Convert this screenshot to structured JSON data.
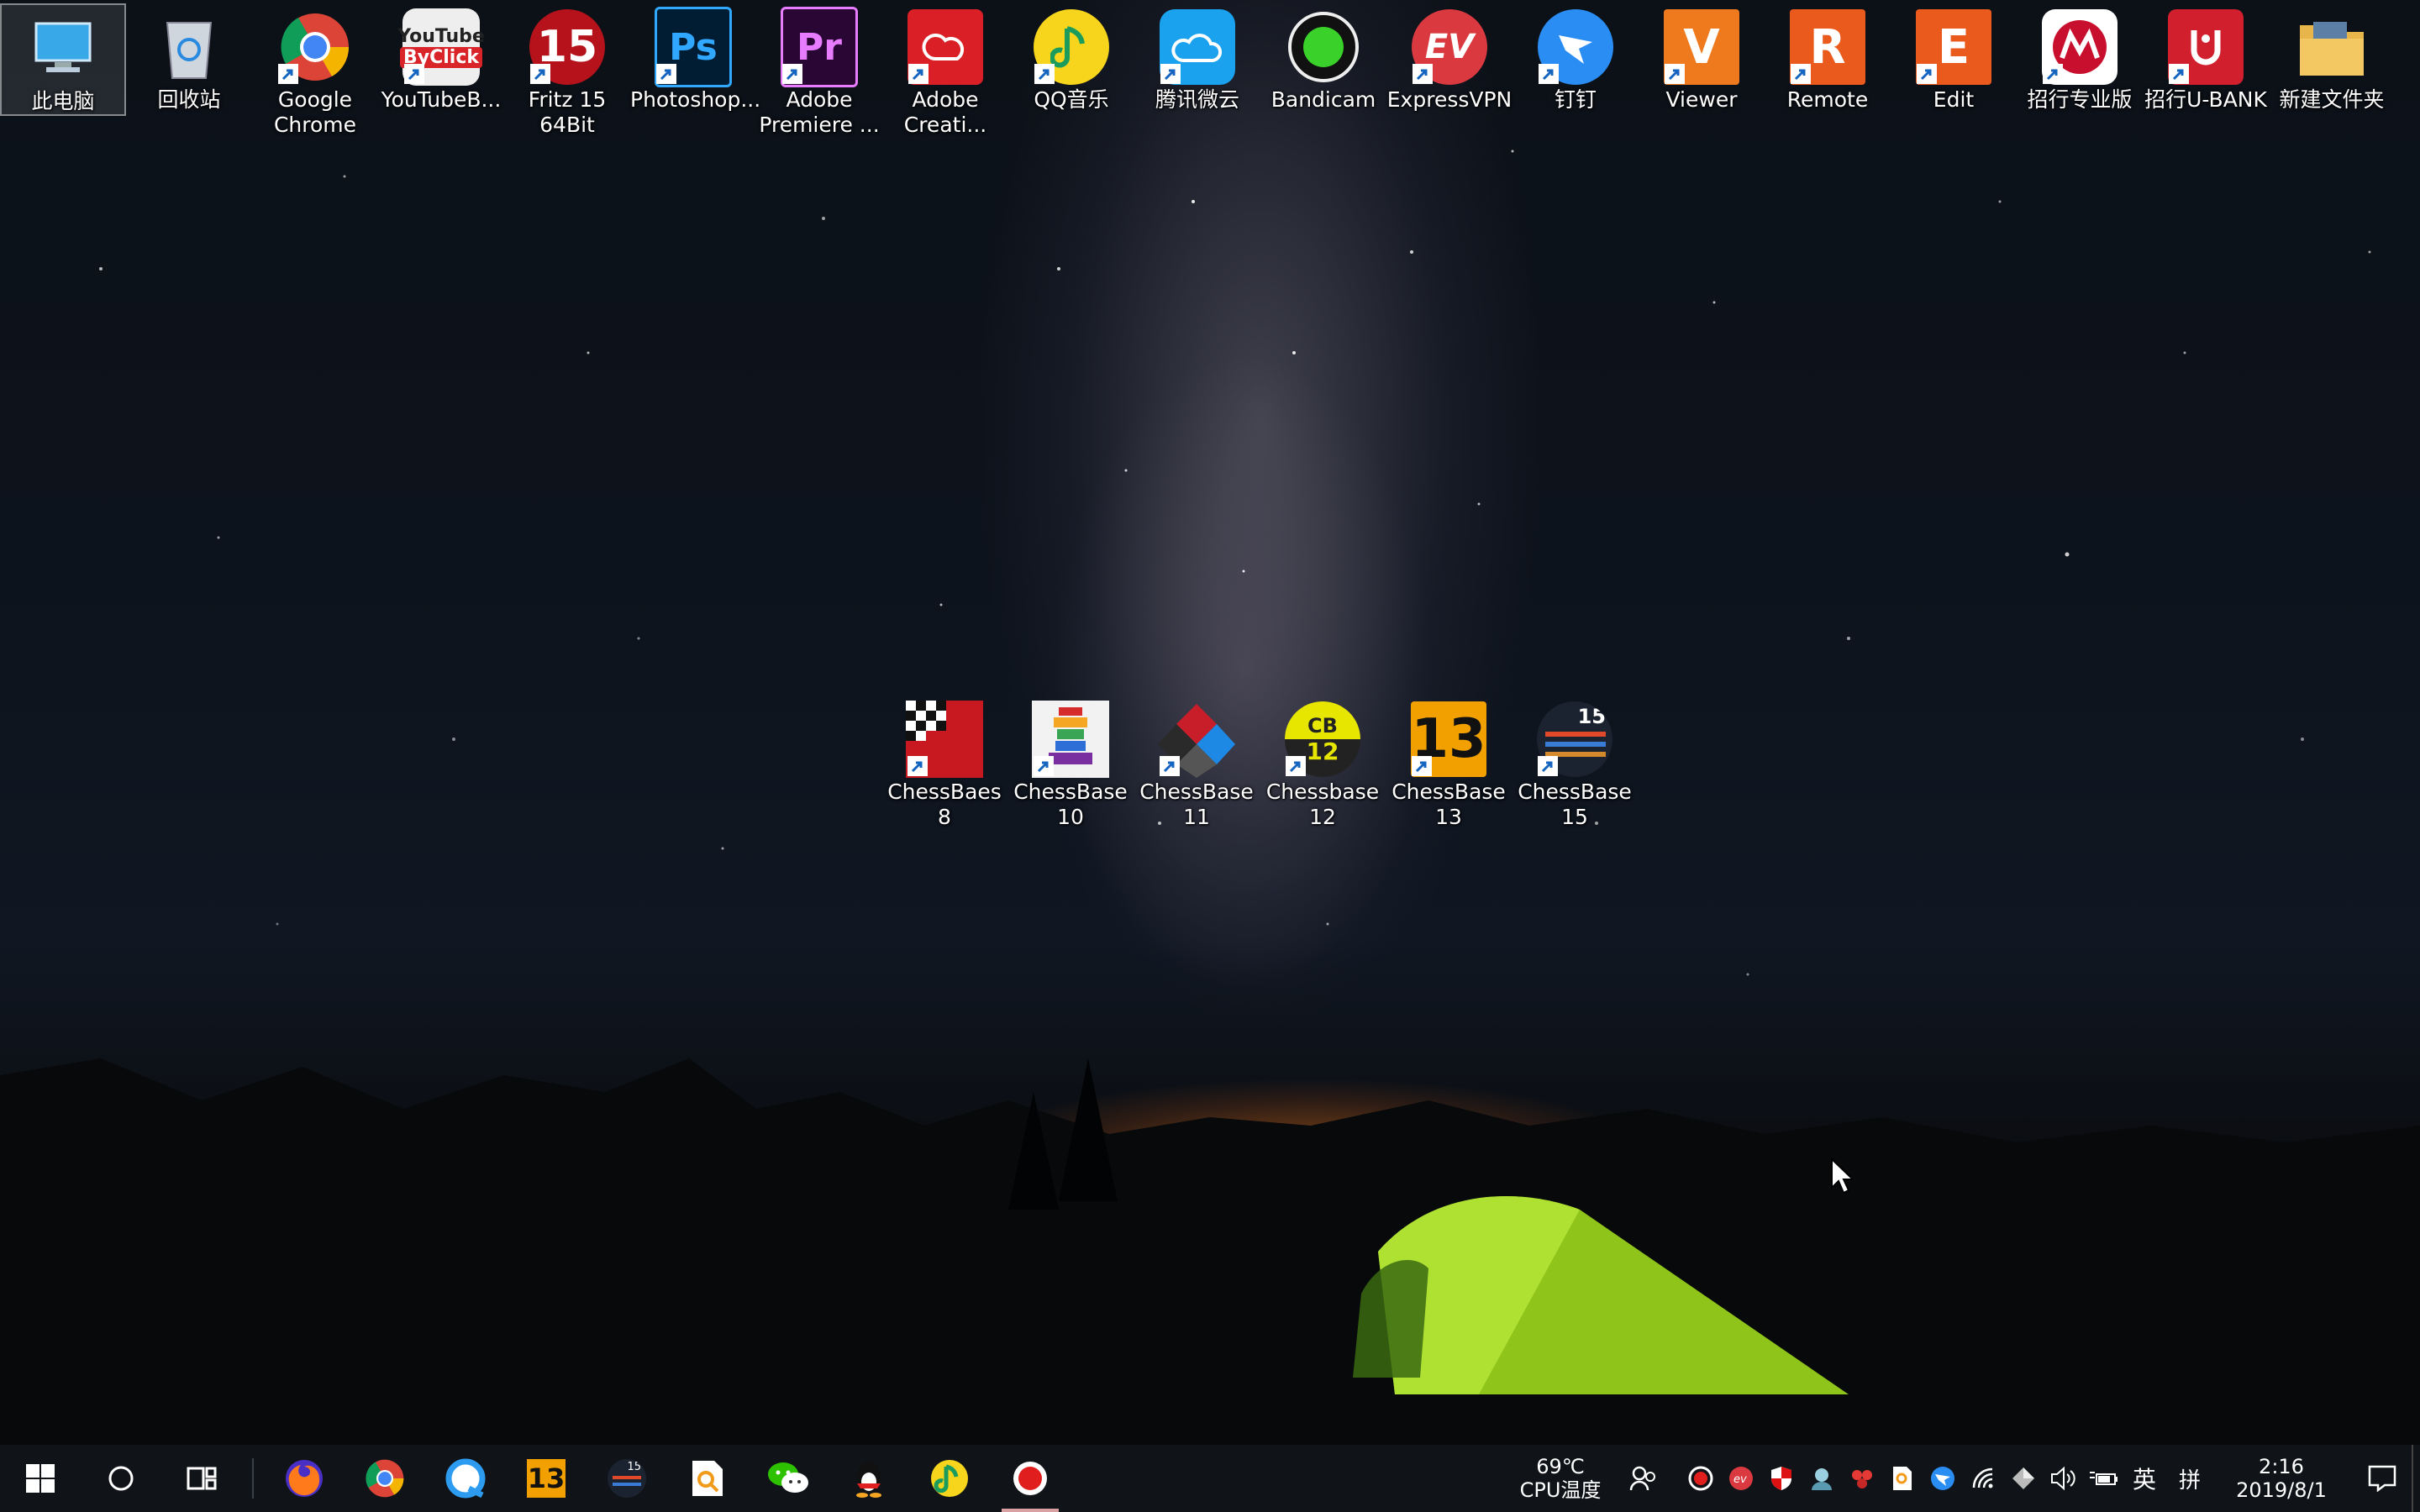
{
  "desktop": {
    "icons_top": [
      {
        "label": "此电脑"
      },
      {
        "label": "回收站"
      },
      {
        "label": "Google\nChrome"
      },
      {
        "label": "YouTubeB..."
      },
      {
        "label": "Fritz 15\n64Bit"
      },
      {
        "label": "Photoshop..."
      },
      {
        "label": "Adobe\nPremiere ..."
      },
      {
        "label": "Adobe\nCreati..."
      },
      {
        "label": "QQ音乐"
      },
      {
        "label": "腾讯微云"
      },
      {
        "label": "Bandicam"
      },
      {
        "label": "ExpressVPN"
      },
      {
        "label": "钉钉"
      },
      {
        "label": "Viewer"
      },
      {
        "label": "Remote"
      },
      {
        "label": "Edit"
      },
      {
        "label": "招行专业版"
      },
      {
        "label": "招行U-BANK"
      },
      {
        "label": "新建文件夹"
      }
    ],
    "icons_chess": [
      {
        "label": "ChessBaes\n8"
      },
      {
        "label": "ChessBase\n10"
      },
      {
        "label": "ChessBase\n11"
      },
      {
        "label": "Chessbase\n12"
      },
      {
        "label": "ChessBase\n13"
      },
      {
        "label": "ChessBase\n15"
      }
    ],
    "icon_text": {
      "youtube_line1": "YouTube",
      "youtube_line2": "ByClick",
      "fritz": "15",
      "ps": "Ps",
      "pr": "Pr",
      "viewer": "V",
      "remote": "R",
      "edit": "E",
      "cb12_top": "CB",
      "cb12_num": "12",
      "cb13": "13",
      "cb15": "15",
      "expressvpn": "EV"
    }
  },
  "taskbar": {
    "cpu_temp": "69℃",
    "cpu_label": "CPU温度",
    "ime_lang": "英",
    "ime_mode": "拼",
    "time": "2:16",
    "date": "2019/8/1",
    "app_13": "13",
    "app_15": "15"
  },
  "colors": {
    "taskbar_bg": "#101418",
    "desktop_sky": "#0d131c",
    "tent_green": "#9ed21e",
    "active_indicator": "#d8a0a0"
  }
}
